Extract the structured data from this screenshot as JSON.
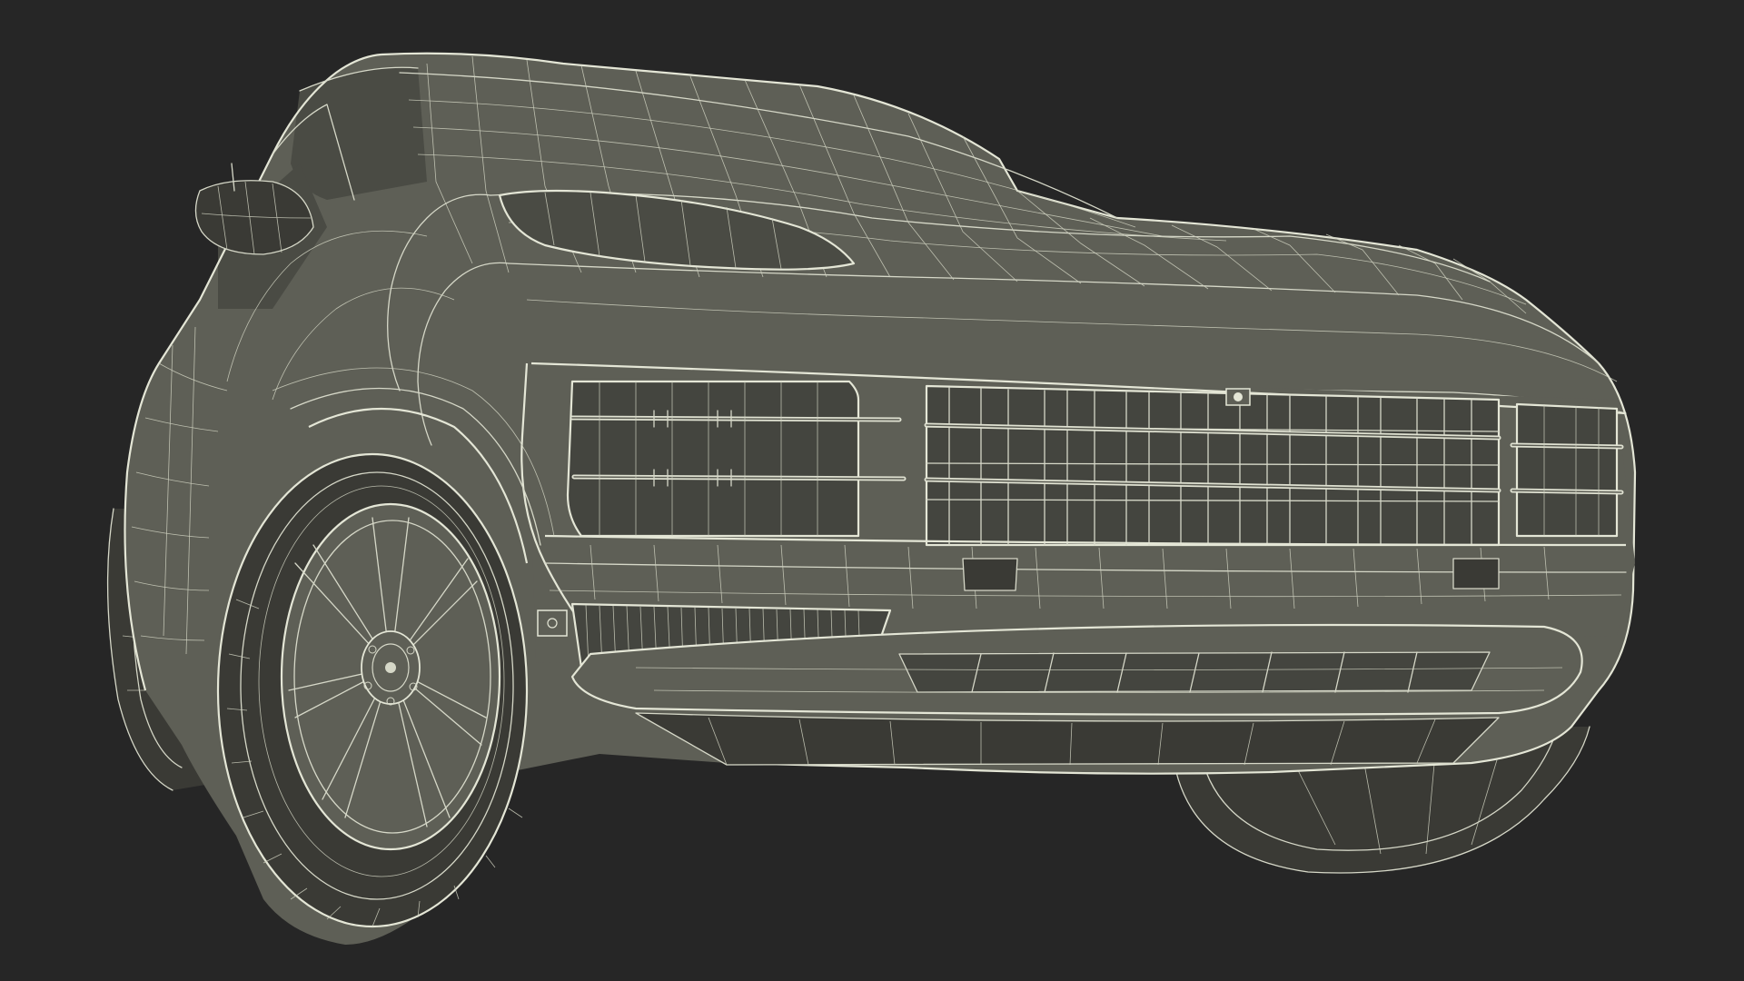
{
  "scene": {
    "colors": {
      "background": "#262626",
      "body": "#5e5f56",
      "wireframe": "#d6d8c8",
      "grille": "#44453f"
    },
    "subject": "suv-wireframe-front-three-quarter"
  }
}
